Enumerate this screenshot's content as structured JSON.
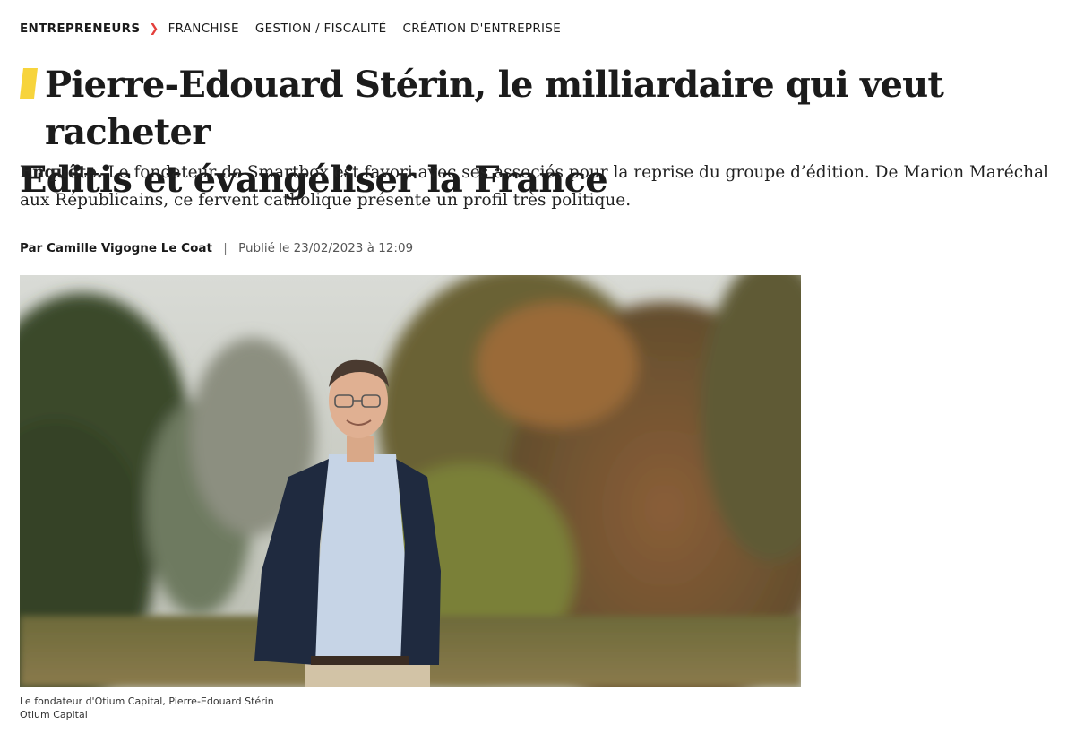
{
  "breadcrumb": {
    "items": [
      {
        "label": "ENTREPRENEURS"
      },
      {
        "label": "FRANCHISE"
      },
      {
        "label": "GESTION / FISCALITÉ"
      },
      {
        "label": "CRÉATION D'ENTREPRISE"
      }
    ],
    "separator_icon": "chevron-right-icon",
    "accent_color": "#e4403c"
  },
  "article": {
    "title_line1": "Pierre-Edouard Stérin, le milliardaire qui veut racheter",
    "title_line2": "Editis et évangéliser la France",
    "title_mark_color": "#f7d43c",
    "lede_kicker": "Enquête.",
    "lede_text": " Le fondateur de Smartbox est favori avec ses associés pour la reprise du groupe d’édition. De Marion Maréchal aux Républicains, ce fervent catholique présente un profil très politique.",
    "byline_author": "Par Camille Vigogne Le Coat",
    "byline_separator": "|",
    "published": "Publié le 23/02/2023 à 12:09",
    "photo_alt": "Le fondateur d'Otium Capital, Pierre-Edouard Stérin",
    "caption_line1": "Le fondateur d'Otium Capital, Pierre-Edouard Stérin",
    "caption_line2": "Otium Capital"
  }
}
